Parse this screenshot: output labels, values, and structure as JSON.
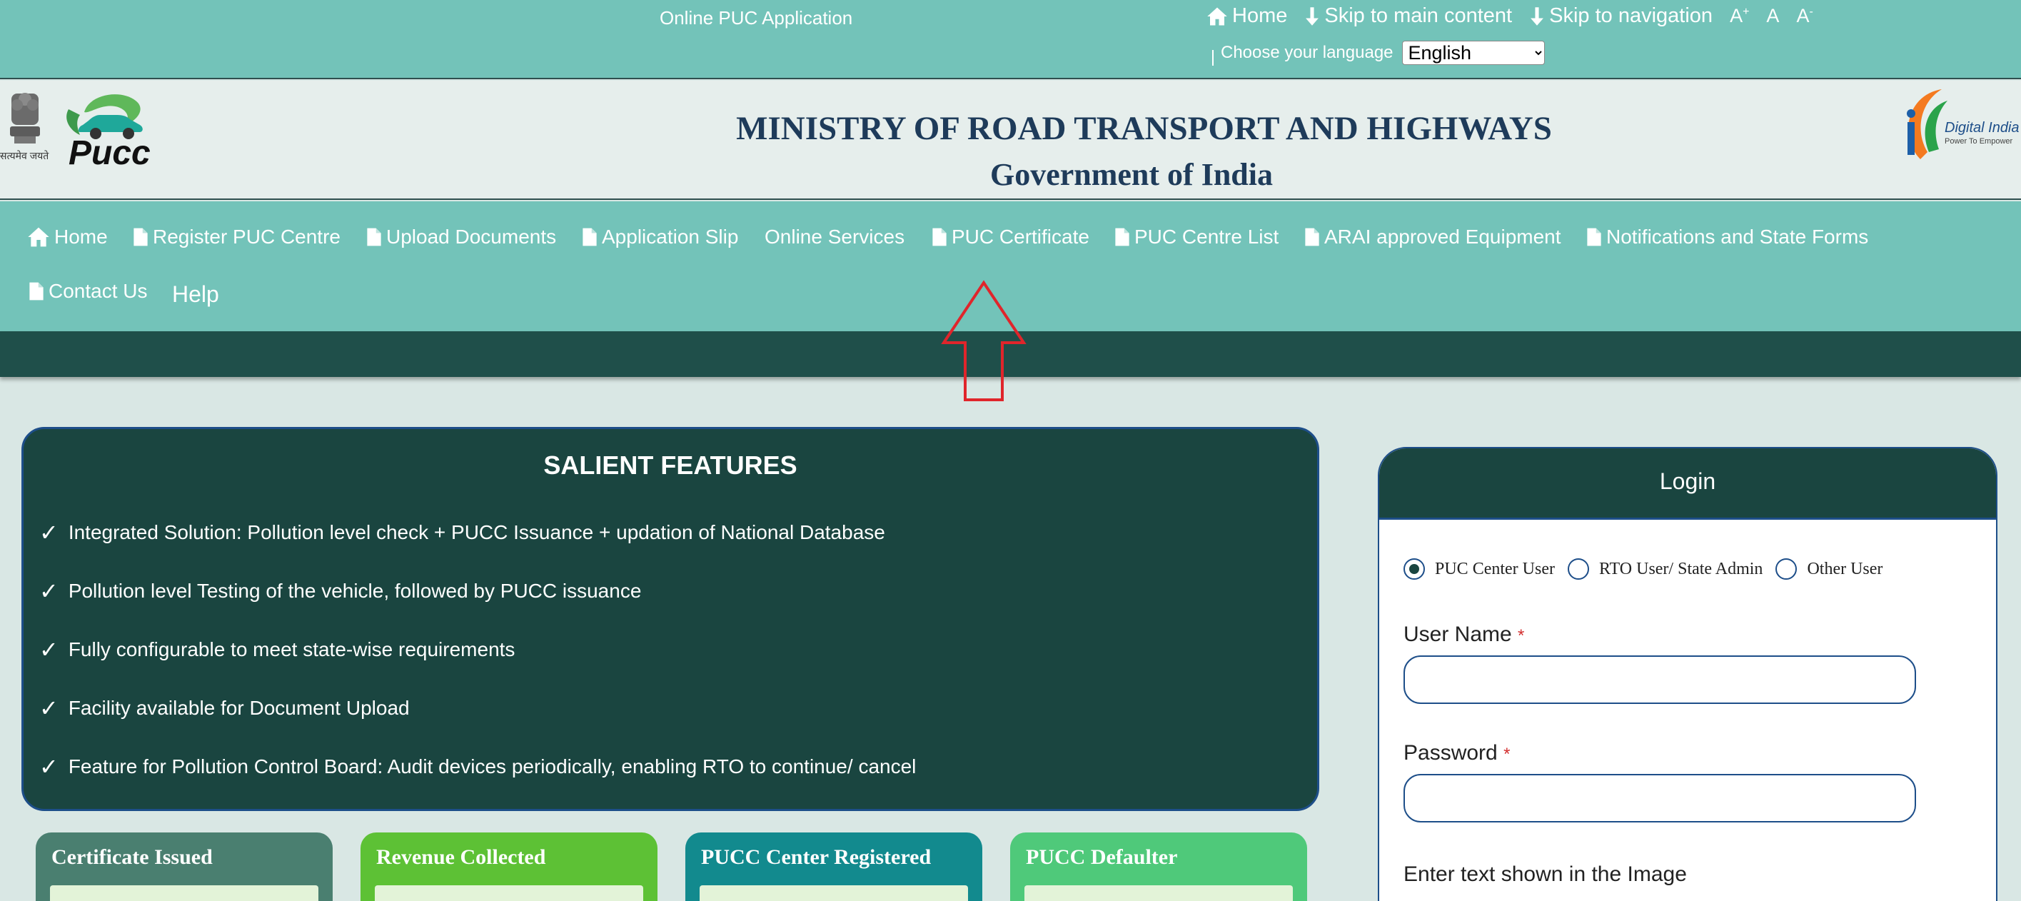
{
  "topbar": {
    "app_title": "Online PUC Application",
    "home_label": "Home",
    "skip_main_label": "Skip to main content",
    "skip_nav_label": "Skip to navigation",
    "font_increase": "A",
    "font_normal": "A",
    "font_decrease": "A",
    "font_increase_mark": "+",
    "font_decrease_mark": "-",
    "language_label": "Choose your language",
    "language_selected": "English"
  },
  "header": {
    "emblem_text": "सत्यमेव जयते",
    "logo_text": "Pucc",
    "ministry": "MINISTRY OF ROAD TRANSPORT AND HIGHWAYS",
    "government": "Government of India",
    "digital_india_title": "Digital India",
    "digital_india_tagline": "Power To Empower"
  },
  "nav": {
    "items": [
      {
        "label": "Home"
      },
      {
        "label": "Register PUC Centre"
      },
      {
        "label": "Upload Documents"
      },
      {
        "label": "Application Slip"
      },
      {
        "label": "Online Services"
      },
      {
        "label": "PUC Certificate"
      },
      {
        "label": "PUC Centre List"
      },
      {
        "label": "ARAI approved Equipment"
      },
      {
        "label": "Notifications and State Forms"
      },
      {
        "label": "Contact Us"
      },
      {
        "label": "Help"
      }
    ]
  },
  "salient": {
    "title": "SALIENT FEATURES",
    "features": [
      "Integrated Solution: Pollution level check + PUCC Issuance + updation of National Database",
      "Pollution level Testing of the vehicle, followed by PUCC issuance",
      "Fully configurable to meet state-wise requirements",
      "Facility available for Document Upload",
      "Feature for Pollution Control Board: Audit devices periodically, enabling RTO to continue/ cancel"
    ],
    "check_glyph": "✓"
  },
  "stats": [
    {
      "title": "Certificate Issued",
      "color": "#4a7f70"
    },
    {
      "title": "Revenue Collected",
      "color": "#5dc135"
    },
    {
      "title": "PUCC Center Registered",
      "color": "#128a8e"
    },
    {
      "title": "PUCC Defaulter",
      "color": "#4fc97a"
    }
  ],
  "login": {
    "title": "Login",
    "user_types": [
      "PUC Center User",
      "RTO User/ State Admin",
      "Other User"
    ],
    "selected_user_type": "PUC Center User",
    "username_label": "User Name",
    "password_label": "Password",
    "required_mark": "*",
    "captcha_label": "Enter text shown in the Image"
  },
  "colors": {
    "topbar": "#73c3b9",
    "dark_green": "#1a4540",
    "border_blue": "#1d4e89",
    "annotation_arrow": "#e0252b"
  }
}
